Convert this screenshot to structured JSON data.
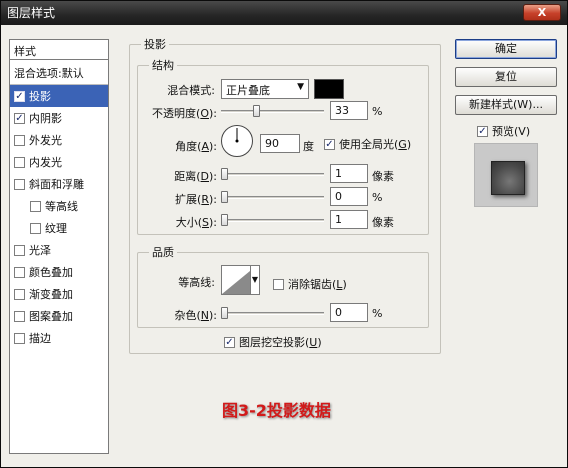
{
  "window": {
    "title": "图层样式",
    "close_glyph": "X"
  },
  "styles_panel": {
    "header": "样式",
    "blend_options": "混合选项:默认",
    "items": [
      {
        "label": "投影",
        "checked": true,
        "selected": true,
        "indent": false
      },
      {
        "label": "内阴影",
        "checked": true,
        "selected": false,
        "indent": false
      },
      {
        "label": "外发光",
        "checked": false,
        "selected": false,
        "indent": false
      },
      {
        "label": "内发光",
        "checked": false,
        "selected": false,
        "indent": false
      },
      {
        "label": "斜面和浮雕",
        "checked": false,
        "selected": false,
        "indent": false
      },
      {
        "label": "等高线",
        "checked": false,
        "selected": false,
        "indent": true
      },
      {
        "label": "纹理",
        "checked": false,
        "selected": false,
        "indent": true
      },
      {
        "label": "光泽",
        "checked": false,
        "selected": false,
        "indent": false
      },
      {
        "label": "颜色叠加",
        "checked": false,
        "selected": false,
        "indent": false
      },
      {
        "label": "渐变叠加",
        "checked": false,
        "selected": false,
        "indent": false
      },
      {
        "label": "图案叠加",
        "checked": false,
        "selected": false,
        "indent": false
      },
      {
        "label": "描边",
        "checked": false,
        "selected": false,
        "indent": false
      }
    ]
  },
  "drop_shadow": {
    "group_title": "投影",
    "structure": {
      "title": "结构",
      "blend_mode_label": "混合模式:",
      "blend_mode_value": "正片叠底",
      "shadow_color": "#000000",
      "opacity_label": "不透明度",
      "opacity_key": "O",
      "opacity_value": "33",
      "opacity_unit": "%",
      "opacity_fraction": 0.33,
      "angle_label": "角度",
      "angle_key": "A",
      "angle_value": "90",
      "angle_unit": "度",
      "global_light_label": "使用全局光",
      "global_light_key": "G",
      "global_light_checked": true,
      "distance_label": "距离",
      "distance_key": "D",
      "distance_value": "1",
      "distance_unit": "像素",
      "spread_label": "扩展",
      "spread_key": "R",
      "spread_value": "0",
      "spread_unit": "%",
      "size_label": "大小",
      "size_key": "S",
      "size_value": "1",
      "size_unit": "像素"
    },
    "quality": {
      "title": "品质",
      "contour_label": "等高线:",
      "antialias_label": "消除锯齿",
      "antialias_key": "L",
      "antialias_checked": false,
      "noise_label": "杂色",
      "noise_key": "N",
      "noise_value": "0",
      "noise_unit": "%"
    },
    "knockout_label": "图层挖空投影",
    "knockout_key": "U",
    "knockout_checked": true
  },
  "buttons": {
    "ok": "确定",
    "reset": "复位",
    "new_style": "新建样式(W)...",
    "preview_label": "预览(V)",
    "preview_checked": true
  },
  "caption": "图3-2投影数据",
  "colors": {
    "selected_bg": "#3b63b6",
    "caption_red": "#d21a1a"
  }
}
